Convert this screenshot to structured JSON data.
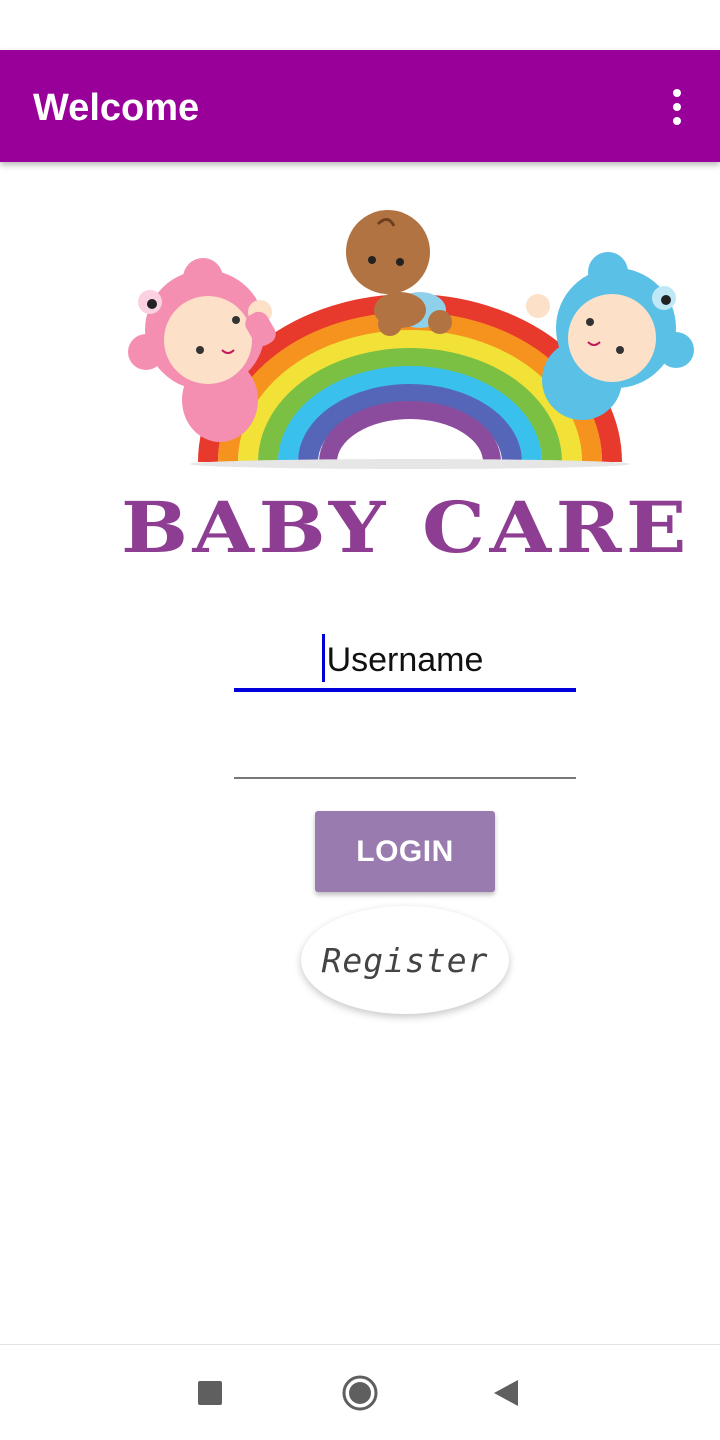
{
  "app_bar": {
    "title": "Welcome",
    "background": "#990099",
    "overflow_icon": "more-vert-icon"
  },
  "logo": {
    "text": "BABY CARE",
    "text_color": "#8e3e92",
    "icon": "babies-rainbow-illustration"
  },
  "form": {
    "username": {
      "value": "Username",
      "focused": true
    },
    "password": {
      "value": ""
    },
    "login_label": "LOGIN",
    "login_color": "#9a7bb0",
    "register_label": "Register"
  },
  "nav_bar": {
    "recents_icon": "square-icon",
    "home_icon": "circle-icon",
    "back_icon": "triangle-back-icon"
  }
}
